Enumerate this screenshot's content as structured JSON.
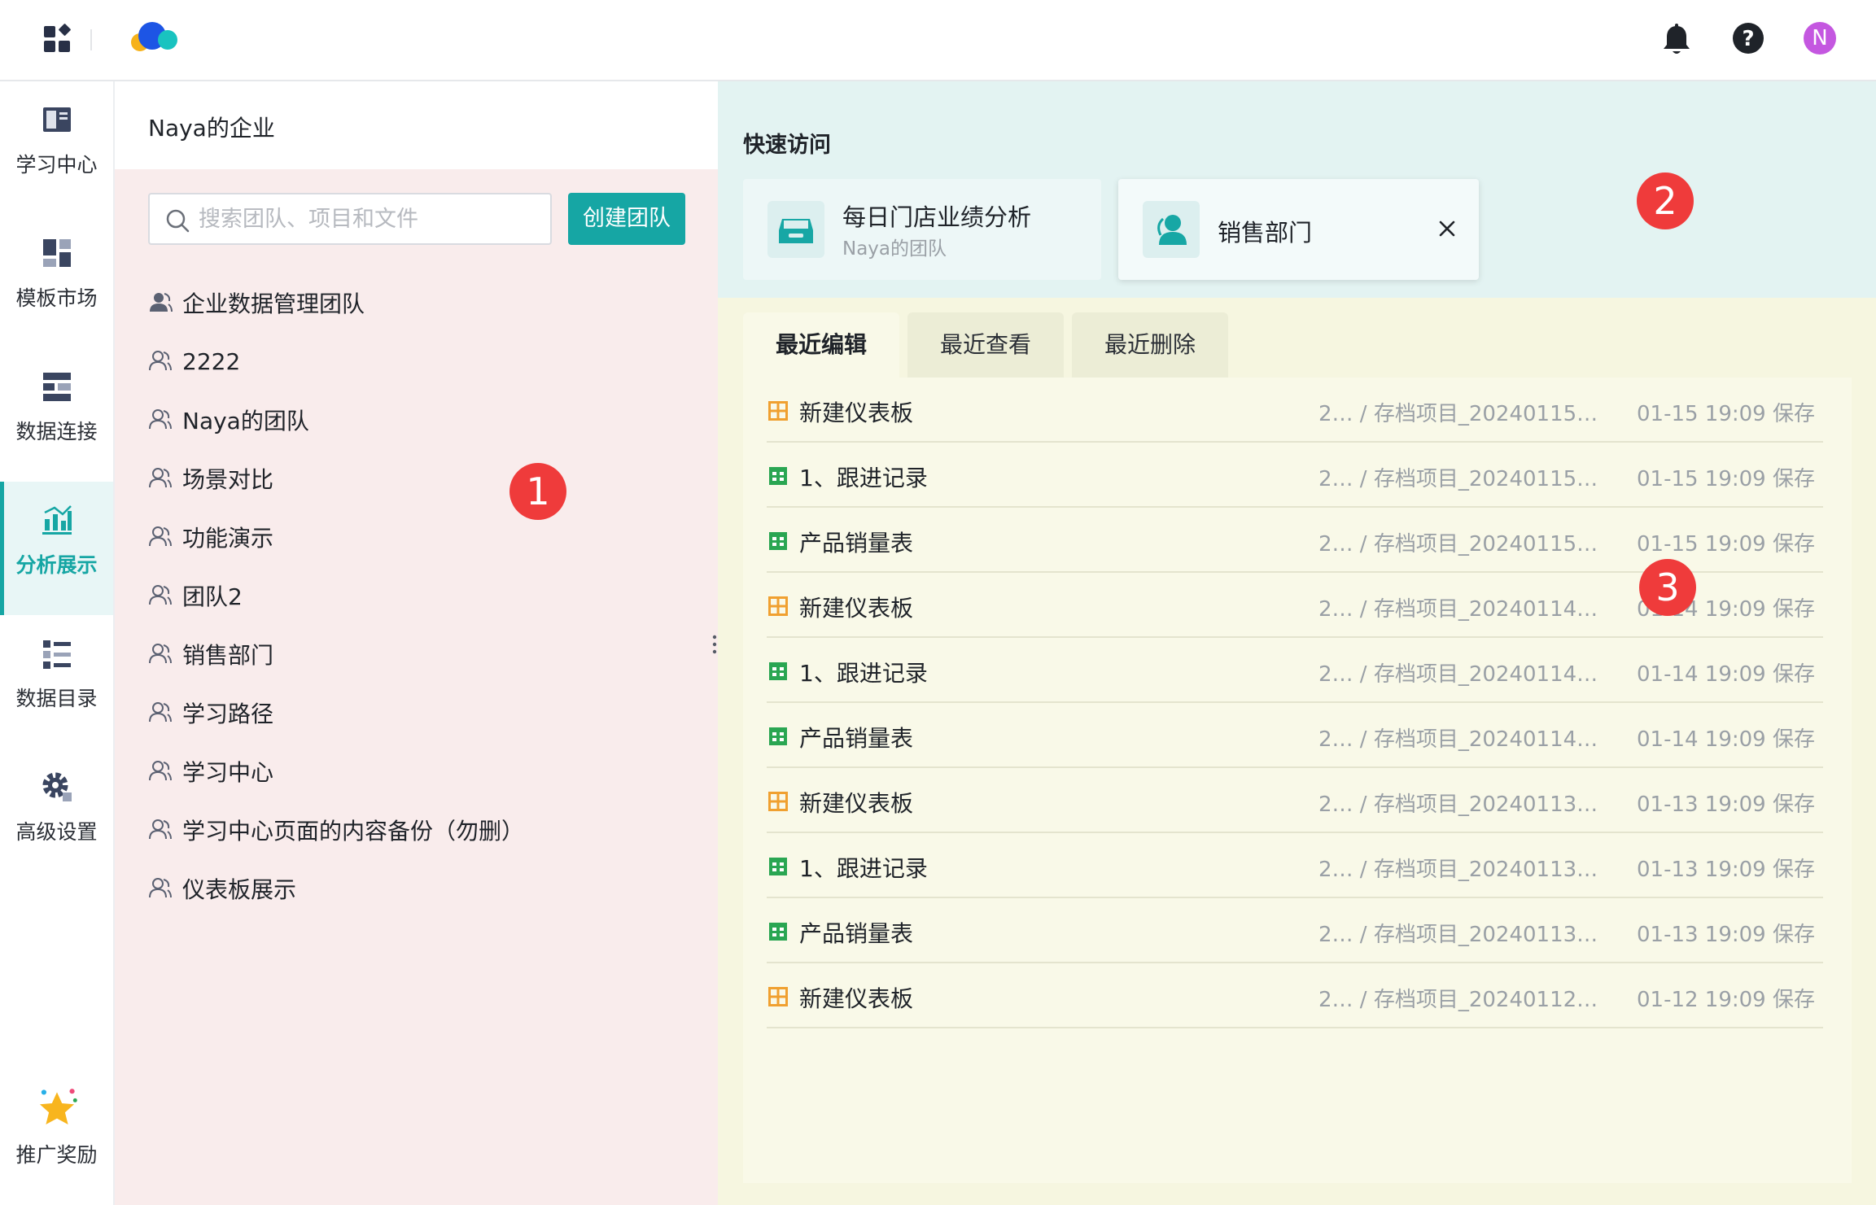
{
  "topbar": {
    "avatar_initial": "N",
    "icons": [
      "apps-grid-icon",
      "logo-icon",
      "bell-icon",
      "help-icon"
    ]
  },
  "rail": {
    "items": [
      {
        "label": "学习中心",
        "icon": "book-icon"
      },
      {
        "label": "模板市场",
        "icon": "template-icon"
      },
      {
        "label": "数据连接",
        "icon": "data-connect-icon"
      },
      {
        "label": "分析展示",
        "icon": "analysis-icon",
        "active": true
      },
      {
        "label": "数据目录",
        "icon": "catalog-icon"
      },
      {
        "label": "高级设置",
        "icon": "gear-icon"
      },
      {
        "label": "推广奖励",
        "icon": "star-reward-icon"
      }
    ]
  },
  "teams": {
    "enterprise_name": "Naya的企业",
    "search_placeholder": "搜索团队、项目和文件",
    "create_label": "创建团队",
    "items": [
      {
        "label": "企业数据管理团队",
        "icon": "enterprise-team-icon"
      },
      {
        "label": "2222",
        "icon": "team-icon"
      },
      {
        "label": "Naya的团队",
        "icon": "team-icon"
      },
      {
        "label": "场景对比",
        "icon": "team-icon"
      },
      {
        "label": "功能演示",
        "icon": "team-icon"
      },
      {
        "label": "团队2",
        "icon": "team-icon"
      },
      {
        "label": "销售部门",
        "icon": "team-icon"
      },
      {
        "label": "学习路径",
        "icon": "team-icon"
      },
      {
        "label": "学习中心",
        "icon": "team-icon"
      },
      {
        "label": "学习中心页面的内容备份（勿删）",
        "icon": "team-icon"
      },
      {
        "label": "仪表板展示",
        "icon": "team-icon"
      }
    ]
  },
  "quick_access": {
    "title": "快速访问",
    "cards": [
      {
        "name": "每日门店业绩分析",
        "sub": "Naya的团队",
        "icon": "project-box-icon"
      },
      {
        "name": "销售部门",
        "sub": "",
        "icon": "team-avatar-icon"
      }
    ]
  },
  "recent": {
    "tabs": [
      "最近编辑",
      "最近查看",
      "最近删除"
    ],
    "rows": [
      {
        "name": "新建仪表板",
        "type": "dashboard",
        "path": "2… / 存档项目_20240115…",
        "time": "01-15 19:09 保存"
      },
      {
        "name": "1、跟进记录",
        "type": "sheet",
        "path": "2… / 存档项目_20240115…",
        "time": "01-15 19:09 保存"
      },
      {
        "name": "产品销量表",
        "type": "sheet",
        "path": "2… / 存档项目_20240115…",
        "time": "01-15 19:09 保存"
      },
      {
        "name": "新建仪表板",
        "type": "dashboard",
        "path": "2… / 存档项目_20240114…",
        "time": "01-14 19:09 保存"
      },
      {
        "name": "1、跟进记录",
        "type": "sheet",
        "path": "2… / 存档项目_20240114…",
        "time": "01-14 19:09 保存"
      },
      {
        "name": "产品销量表",
        "type": "sheet",
        "path": "2… / 存档项目_20240114…",
        "time": "01-14 19:09 保存"
      },
      {
        "name": "新建仪表板",
        "type": "dashboard",
        "path": "2… / 存档项目_20240113…",
        "time": "01-13 19:09 保存"
      },
      {
        "name": "1、跟进记录",
        "type": "sheet",
        "path": "2… / 存档项目_20240113…",
        "time": "01-13 19:09 保存"
      },
      {
        "name": "产品销量表",
        "type": "sheet",
        "path": "2… / 存档项目_20240113…",
        "time": "01-13 19:09 保存"
      },
      {
        "name": "新建仪表板",
        "type": "dashboard",
        "path": "2… / 存档项目_20240112…",
        "time": "01-12 19:09 保存"
      }
    ]
  },
  "badges": [
    "1",
    "2",
    "3"
  ],
  "colors": {
    "accent": "#16a6a4",
    "region1_bg": "#f9ecec",
    "region2_bg": "#e3f3f2",
    "region3_bg": "#f6f6e0",
    "badge": "#ef3b3b",
    "dashboard_icon": "#f0a030",
    "sheet_icon": "#2aa652"
  }
}
